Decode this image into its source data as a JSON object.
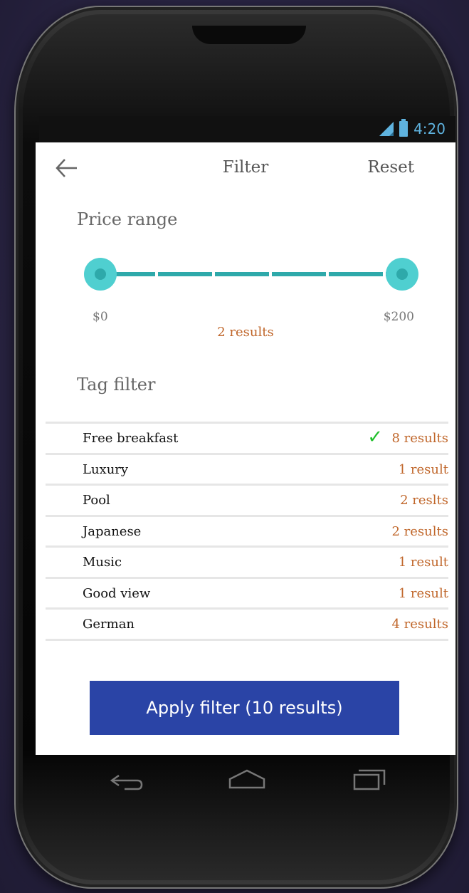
{
  "status_bar": {
    "time": "4:20",
    "accent_color": "#5fb3df"
  },
  "header": {
    "title": "Filter",
    "reset_label": "Reset",
    "back_icon": "arrow-left-icon"
  },
  "price": {
    "section_title": "Price range",
    "min_label": "$0",
    "max_label": "$200",
    "results_label": "2 results",
    "range_min_fraction": 0,
    "range_max_fraction": 1,
    "accent_color": "#4fcfd0"
  },
  "tags": {
    "section_title": "Tag filter",
    "items": [
      {
        "name": "Free breakfast",
        "count": "8 results",
        "checked": true
      },
      {
        "name": "Luxury",
        "count": "1 result",
        "checked": false
      },
      {
        "name": "Pool",
        "count": "2 reslts",
        "checked": false
      },
      {
        "name": "Japanese",
        "count": "2 results",
        "checked": false
      },
      {
        "name": "Music",
        "count": "1 result",
        "checked": false
      },
      {
        "name": "Good view",
        "count": "1 result",
        "checked": false
      },
      {
        "name": "German",
        "count": "4 results",
        "checked": false
      }
    ],
    "count_color": "#c0662a",
    "check_icon": "checkmark-icon",
    "check_color": "#1fbf2a"
  },
  "apply": {
    "label": "Apply filter (10 results)",
    "color": "#2a44a6"
  },
  "nav": {
    "back_icon": "nav-back-icon",
    "home_icon": "nav-home-icon",
    "recent_icon": "nav-recent-apps-icon"
  }
}
